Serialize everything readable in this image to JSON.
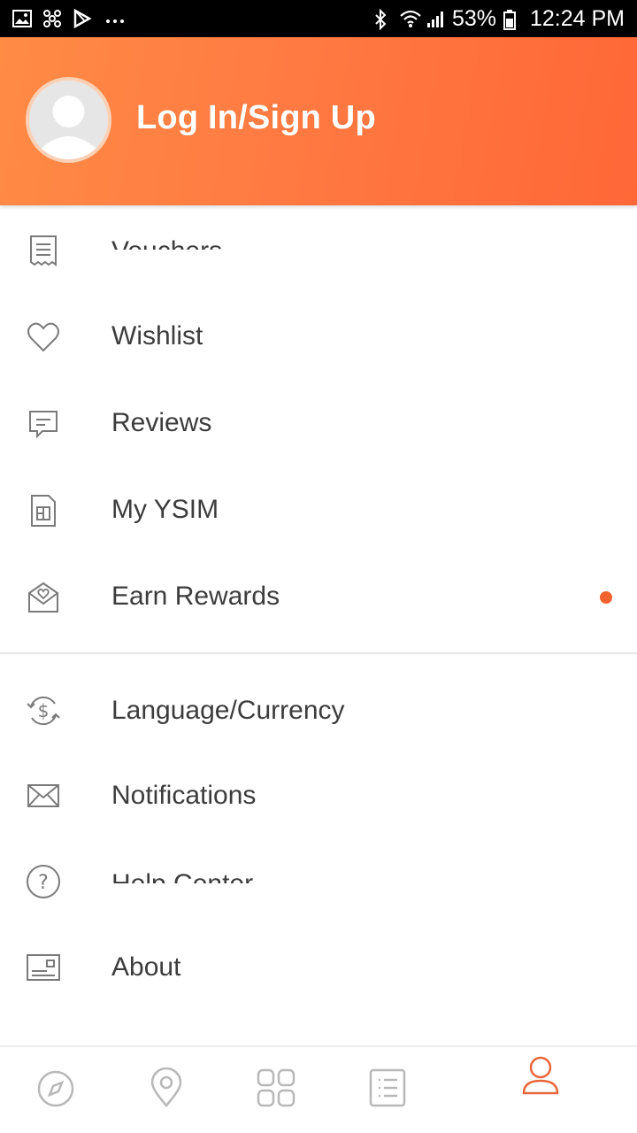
{
  "status_bar": {
    "battery": "53%",
    "time": "12:24 PM",
    "left_icons": [
      "gallery-icon",
      "pinwheel-icon",
      "play-store-icon",
      "more-dots-icon"
    ],
    "right_icons": [
      "bluetooth-icon",
      "wifi-icon",
      "signal-icon",
      "battery-icon"
    ]
  },
  "header": {
    "title": "Log In/Sign Up",
    "gradient_start": "#ff8b45",
    "gradient_end": "#ff6737"
  },
  "menu": {
    "section1": [
      {
        "label": "Vouchers",
        "icon": "receipt-icon",
        "clipped": true
      },
      {
        "label": "Wishlist",
        "icon": "heart-icon"
      },
      {
        "label": "Reviews",
        "icon": "comment-icon"
      },
      {
        "label": "My YSIM",
        "icon": "sim-card-icon"
      },
      {
        "label": "Earn Rewards",
        "icon": "heart-envelope-icon",
        "badge": true
      }
    ],
    "section2": [
      {
        "label": "Language/Currency",
        "icon": "currency-exchange-icon"
      },
      {
        "label": "Notifications",
        "icon": "envelope-icon"
      },
      {
        "label": "Help Center",
        "icon": "help-circle-icon",
        "clipped": true
      },
      {
        "label": "About",
        "icon": "about-card-icon"
      }
    ]
  },
  "bottom_nav": {
    "items": [
      "compass-icon",
      "location-pin-icon",
      "grid-icon",
      "list-icon",
      "profile-icon"
    ],
    "active": "profile-icon",
    "active_color": "#e8673a",
    "inactive_color": "#b8b8b8"
  },
  "colors": {
    "badge": "#f2622e",
    "text": "#3c3c3c",
    "icon": "#7a7a7a"
  }
}
